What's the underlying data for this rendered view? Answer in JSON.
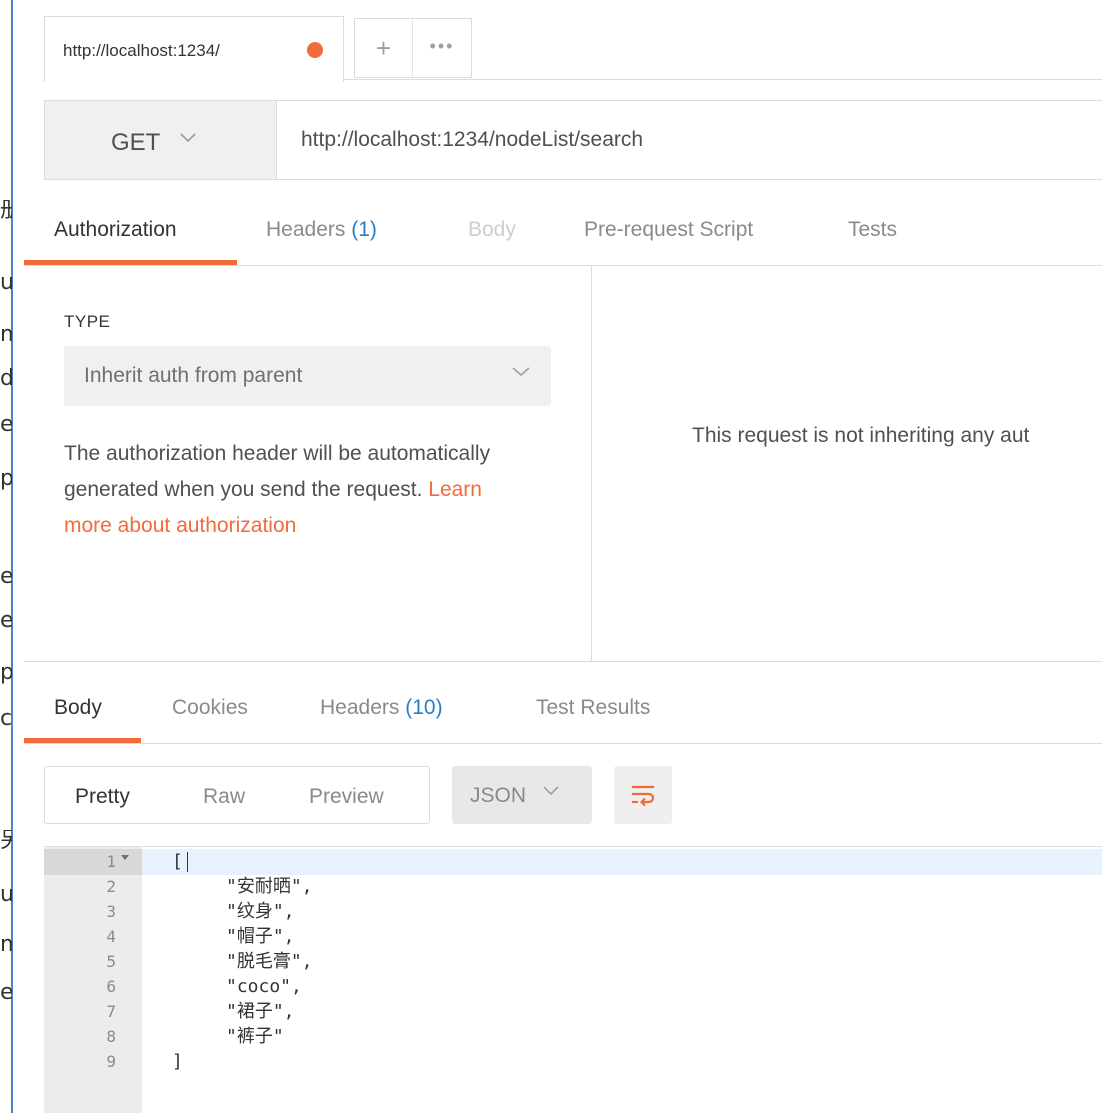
{
  "left_strip": {
    "chars": [
      "册",
      "ur",
      "m",
      "da",
      "e",
      "pa",
      "e",
      "e",
      "pa",
      "cc",
      "另",
      "ur",
      "m",
      "e"
    ]
  },
  "tab": {
    "title": "http://localhost:1234/",
    "plus": "+",
    "more": "•••"
  },
  "request": {
    "method": "GET",
    "url": "http://localhost:1234/nodeList/search"
  },
  "request_tabs": {
    "authorization": "Authorization",
    "headers": "Headers",
    "headers_count": "(1)",
    "body": "Body",
    "prerequest": "Pre-request Script",
    "tests": "Tests"
  },
  "auth": {
    "type_label": "TYPE",
    "type_value": "Inherit auth from parent",
    "desc": "The authorization header will be automatically generated when you send the request. ",
    "link": "Learn more about authorization",
    "right_text": "This request is not inheriting any aut"
  },
  "response_tabs": {
    "body": "Body",
    "cookies": "Cookies",
    "headers": "Headers",
    "headers_count": "(10)",
    "test_results": "Test Results"
  },
  "view_modes": {
    "pretty": "Pretty",
    "raw": "Raw",
    "preview": "Preview",
    "format": "JSON"
  },
  "code_lines": [
    {
      "n": "1",
      "text": "["
    },
    {
      "n": "2",
      "text": "\"安耐晒\","
    },
    {
      "n": "3",
      "text": "\"纹身\","
    },
    {
      "n": "4",
      "text": "\"帽子\","
    },
    {
      "n": "5",
      "text": "\"脱毛膏\","
    },
    {
      "n": "6",
      "text": "\"coco\","
    },
    {
      "n": "7",
      "text": "\"裙子\","
    },
    {
      "n": "8",
      "text": "\"裤子\""
    },
    {
      "n": "9",
      "text": "]"
    }
  ],
  "colors": {
    "accent": "#f26b3a",
    "link": "#2c7cc8",
    "string": "#1a1aa6"
  }
}
